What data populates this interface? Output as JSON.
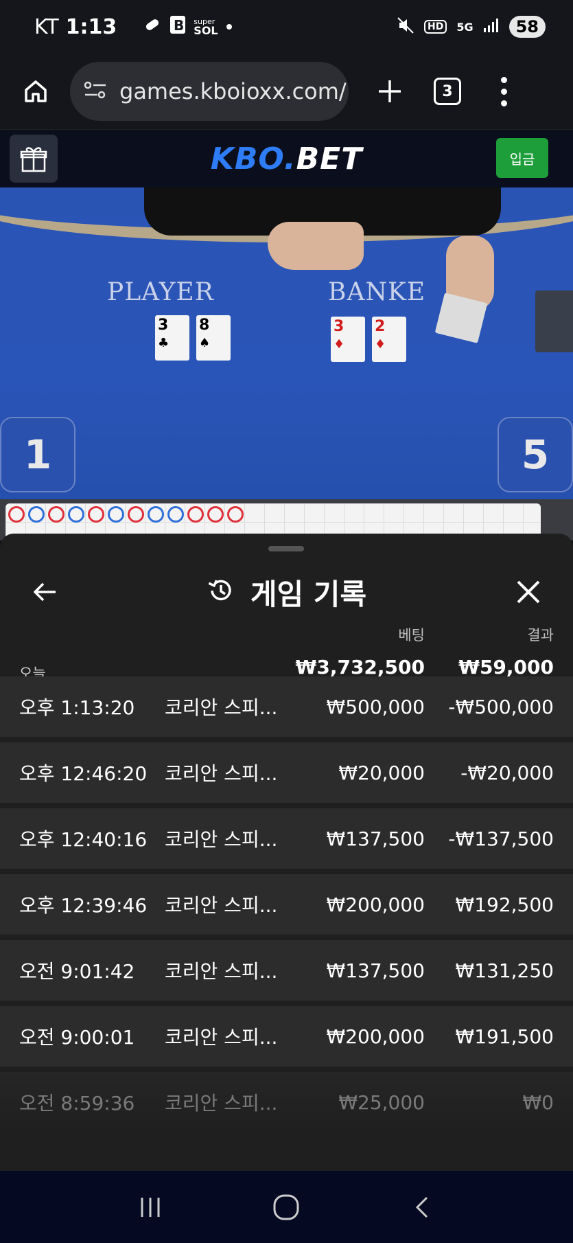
{
  "status": {
    "carrier": "KT",
    "time": "1:13",
    "notification_icons": [
      "link-icon",
      "b-app-icon",
      "super-sol-icon",
      "dot-icon"
    ],
    "super_sol_top": "super",
    "super_sol_bottom": "SOL",
    "battery": "58",
    "network": "5G",
    "hd": "HD"
  },
  "browser": {
    "url": "games.kboioxx.com/",
    "tab_count": "3"
  },
  "site": {
    "logo_kbo": "KBO.",
    "logo_bet": "BET",
    "deposit_label": "입금"
  },
  "video": {
    "player_label": "PLAYER",
    "banker_label": "BANKE",
    "player_cards": [
      {
        "rank": "3",
        "suit": "♣",
        "color": "#000000"
      },
      {
        "rank": "8",
        "suit": "♠",
        "color": "#000000"
      }
    ],
    "banker_cards": [
      {
        "rank": "3",
        "suit": "♦",
        "color": "#d21b1b"
      },
      {
        "rank": "2",
        "suit": "♦",
        "color": "#d21b1b"
      }
    ],
    "left_number": "1",
    "right_number": "5"
  },
  "history": {
    "title": "게임 기록",
    "bet_header": "베팅",
    "result_header": "결과",
    "today_label": "오늘",
    "total_bet": "₩3,732,500",
    "total_result": "₩59,000",
    "rows": [
      {
        "time": "오후 1:13:20",
        "game": "코리안 스피...",
        "bet": "₩500,000",
        "result": "-₩500,000"
      },
      {
        "time": "오후 12:46:20",
        "game": "코리안 스피...",
        "bet": "₩20,000",
        "result": "-₩20,000"
      },
      {
        "time": "오후 12:40:16",
        "game": "코리안 스피...",
        "bet": "₩137,500",
        "result": "-₩137,500"
      },
      {
        "time": "오후 12:39:46",
        "game": "코리안 스피...",
        "bet": "₩200,000",
        "result": "₩192,500"
      },
      {
        "time": "오전 9:01:42",
        "game": "코리안 스피...",
        "bet": "₩137,500",
        "result": "₩131,250"
      },
      {
        "time": "오전 9:00:01",
        "game": "코리안 스피...",
        "bet": "₩200,000",
        "result": "₩191,500"
      },
      {
        "time": "오전 8:59:36",
        "game": "코리안 스피...",
        "bet": "₩25,000",
        "result": "₩0"
      }
    ]
  },
  "roadmap": {
    "colors": {
      "banker": "#e0303a",
      "player": "#2e6fd8"
    },
    "sequence": [
      "banker",
      "player",
      "banker",
      "player",
      "banker",
      "player",
      "banker",
      "player",
      "player",
      "banker",
      "banker",
      "banker"
    ]
  },
  "colors": {
    "accent_blue": "#2e7cf6",
    "deposit_green": "#1e9e3a",
    "sheet_bg": "#1f1f1f",
    "row_bg": "#2c2c2c"
  }
}
